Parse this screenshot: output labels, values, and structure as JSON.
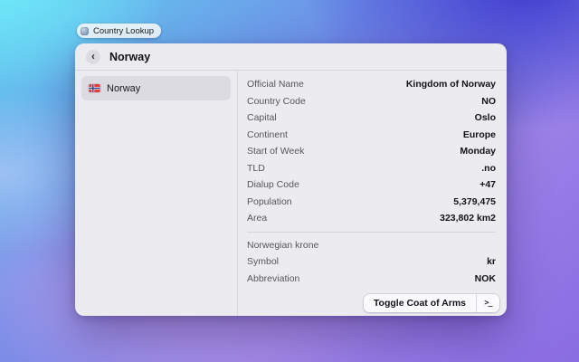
{
  "desktop": {
    "app_pill": {
      "label": "Country Lookup"
    }
  },
  "window": {
    "header": {
      "title": "Norway",
      "back_icon": "‹"
    },
    "sidebar": {
      "items": [
        {
          "label": "Norway",
          "flag": "norway-flag"
        }
      ]
    },
    "details": {
      "rows": [
        {
          "label": "Official Name",
          "value": "Kingdom of Norway"
        },
        {
          "label": "Country Code",
          "value": "NO"
        },
        {
          "label": "Capital",
          "value": "Oslo"
        },
        {
          "label": "Continent",
          "value": "Europe"
        },
        {
          "label": "Start of Week",
          "value": "Monday"
        },
        {
          "label": "TLD",
          "value": ".no"
        },
        {
          "label": "Dialup Code",
          "value": "+47"
        },
        {
          "label": "Population",
          "value": "5,379,475"
        },
        {
          "label": "Area",
          "value": "323,802 km2"
        }
      ],
      "currency": {
        "title": "Norwegian krone",
        "rows": [
          {
            "label": "Symbol",
            "value": "kr"
          },
          {
            "label": "Abbreviation",
            "value": "NOK"
          }
        ]
      }
    },
    "footer": {
      "toggle_button": "Toggle Coat of Arms",
      "terminal_icon": ">_"
    }
  },
  "colors": {
    "window_bg": "#ecebef",
    "selected_item_bg": "#dcdbe1",
    "divider": "#d7d6db",
    "label_text": "#56565b",
    "value_text": "#131315",
    "desktop_gradient_top_left": "#6fe7f8",
    "desktop_gradient_top_right": "#3e3ccf",
    "desktop_gradient_bottom_right": "#8a6ce2",
    "desktop_gradient_bottom_left": "#c9a0ec"
  }
}
